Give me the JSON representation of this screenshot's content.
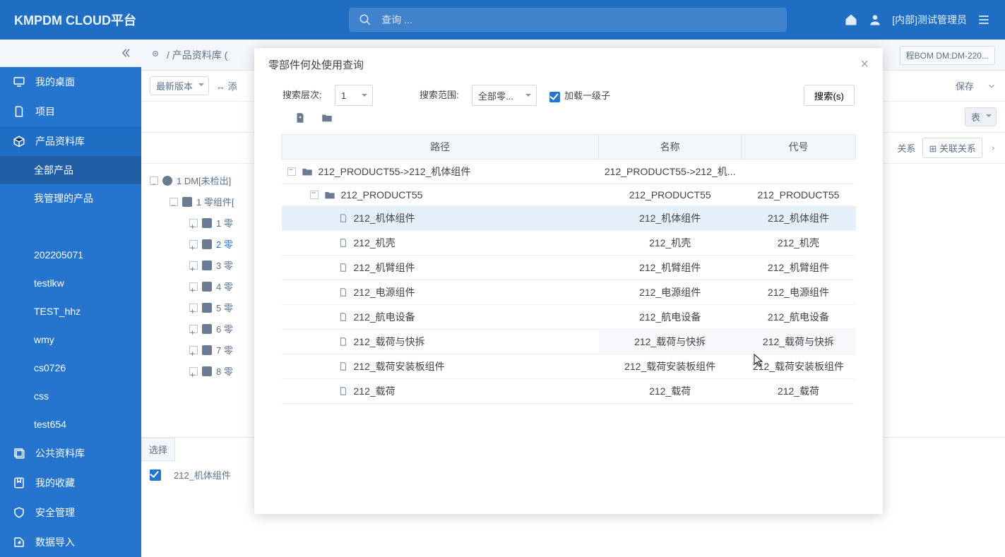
{
  "header": {
    "brand": "KMPDM CLOUD平台",
    "search_placeholder": "查询 ...",
    "username": "[内部]测试管理员"
  },
  "sidebar": {
    "items": [
      {
        "label": "我的桌面",
        "icon": "desktop"
      },
      {
        "label": "项目",
        "icon": "project"
      },
      {
        "label": "产品资料库",
        "icon": "box",
        "active": true
      },
      {
        "label": "公共资料库",
        "icon": "stack"
      },
      {
        "label": "我的收藏",
        "icon": "bookmark"
      },
      {
        "label": "安全管理",
        "icon": "shield"
      },
      {
        "label": "数据导入",
        "icon": "import"
      }
    ],
    "sub_product": [
      {
        "label": "全部产品",
        "selected": true
      },
      {
        "label": "我管理的产品"
      },
      {
        "label": "",
        "blurred": true
      },
      {
        "label": "202205071"
      },
      {
        "label": "testlkw"
      },
      {
        "label": "TEST_hhz"
      },
      {
        "label": "wmy"
      },
      {
        "label": "cs0726"
      },
      {
        "label": "css"
      },
      {
        "label": "test654"
      }
    ]
  },
  "crumb": {
    "text": "/ 产品资料库 ("
  },
  "right_tabs": {
    "partial": "程BOM DM:DM-220...",
    "save": "保存",
    "relation1": "关系",
    "relation2": "关联关系"
  },
  "toolbar": {
    "version": "最新版本",
    "add": "添",
    "filter_btn": "表"
  },
  "tree": {
    "root": "1 DM[未检出]",
    "l1": "1 零组件[",
    "children": [
      "1 零",
      "2 零",
      "3 零",
      "4 零",
      "5 零",
      "6 零",
      "7 零",
      "8 零"
    ]
  },
  "bottom": {
    "select": "选择",
    "row_label": "212_机体组件"
  },
  "dialog": {
    "title": "零部件何处使用查询",
    "form": {
      "level_label": "搜索层次:",
      "level_value": "1",
      "scope_label": "搜索范围:",
      "scope_value": "全部零...",
      "load_label": "加载一级子",
      "search_btn": "搜索(s)"
    },
    "columns": [
      "路径",
      "名称",
      "代号"
    ],
    "rows": [
      {
        "indent": 0,
        "toggle": true,
        "folder": true,
        "path": "212_PRODUCT55->212_机体组件",
        "name": "212_PRODUCT55->212_机...",
        "code": ""
      },
      {
        "indent": 1,
        "toggle": true,
        "folder": true,
        "path": "212_PRODUCT55",
        "name": "212_PRODUCT55",
        "code": "212_PRODUCT55"
      },
      {
        "indent": 2,
        "doc": true,
        "path": "212_机体组件",
        "name": "212_机体组件",
        "code": "212_机体组件",
        "selected": true
      },
      {
        "indent": 2,
        "doc": true,
        "path": "212_机壳",
        "name": "212_机壳",
        "code": "212_机壳"
      },
      {
        "indent": 2,
        "doc": true,
        "path": "212_机臂组件",
        "name": "212_机臂组件",
        "code": "212_机臂组件"
      },
      {
        "indent": 2,
        "doc": true,
        "path": "212_电源组件",
        "name": "212_电源组件",
        "code": "212_电源组件"
      },
      {
        "indent": 2,
        "doc": true,
        "path": "212_航电设备",
        "name": "212_航电设备",
        "code": "212_航电设备"
      },
      {
        "indent": 2,
        "doc": true,
        "path": "212_载荷与快拆",
        "name": "212_载荷与快拆",
        "code": "212_载荷与快拆",
        "hover": true
      },
      {
        "indent": 2,
        "doc": true,
        "path": "212_载荷安装板组件",
        "name": "212_载荷安装板组件",
        "code": "212_载荷安装板组件"
      },
      {
        "indent": 2,
        "doc": true,
        "path": "212_载荷",
        "name": "212_载荷",
        "code": "212_载荷"
      }
    ]
  }
}
